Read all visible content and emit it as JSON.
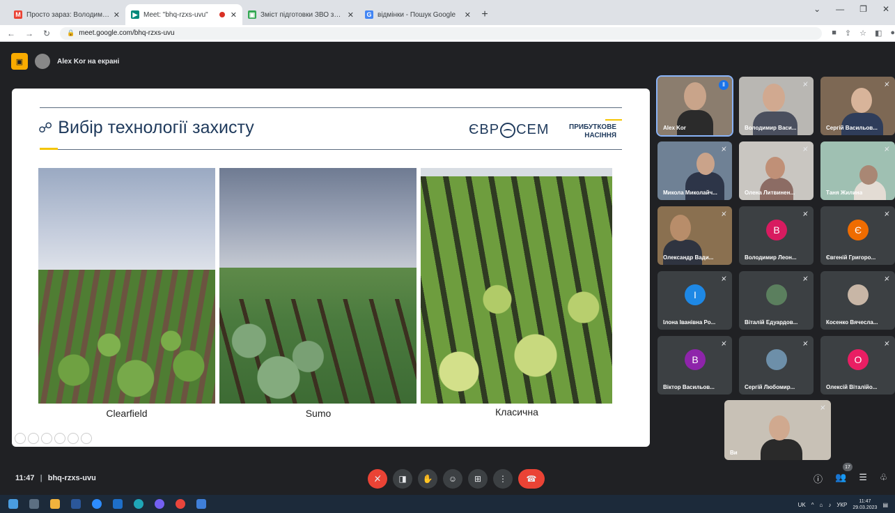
{
  "browser": {
    "tabs": [
      {
        "title": "Просто зараз: Володимир Вас...",
        "fav_color": "#ea4335",
        "fav": "M"
      },
      {
        "title": "Meet: \"bhq-rzxs-uvu\"",
        "fav_color": "#00897b",
        "fav": "▶"
      },
      {
        "title": "Зміст підготовки ЗВО за освітн...",
        "fav_color": "#34a853",
        "fav": "▣"
      },
      {
        "title": "відмінки - Пошук Google",
        "fav_color": "#4285f4",
        "fav": "G"
      }
    ],
    "url": "meet.google.com/bhq-rzxs-uvu"
  },
  "meet": {
    "presenter_label": "Alex Kor на екрані",
    "meeting_code": "bhq-rzxs-uvu",
    "time": "11:47",
    "participants_count": "17",
    "slide": {
      "title": "Вибір технології захисту",
      "brand_left": "ЄВР",
      "brand_right": "СЕМ",
      "brand_sub1": "ПРИБУТКОВЕ",
      "brand_sub2": "НАСІННЯ",
      "captions": [
        "Clearfield",
        "Sumo",
        "Класична"
      ]
    },
    "participants": [
      {
        "name": "Alex Kor"
      },
      {
        "name": "Володимир Васи..."
      },
      {
        "name": "Сергій Васильов..."
      },
      {
        "name": "Микола Миколайч..."
      },
      {
        "name": "Олена Литвинен..."
      },
      {
        "name": "Таня Жилина"
      },
      {
        "name": "Олександр Вади..."
      },
      {
        "name": "Володимир Леон...",
        "initial": "В"
      },
      {
        "name": "Євгеній Григоро...",
        "initial": "Є"
      },
      {
        "name": "Ілона Іванівна Ро...",
        "initial": "І"
      },
      {
        "name": "Віталій Едуардов..."
      },
      {
        "name": "Косенко Вячесла..."
      },
      {
        "name": "Віктор Васильов...",
        "initial": "В"
      },
      {
        "name": "Сергій Любомир..."
      },
      {
        "name": "Олексій Віталійо...",
        "initial": "О"
      },
      {
        "name": "Ви"
      }
    ]
  },
  "taskbar": {
    "lang": "УКР",
    "time": "11:47",
    "date": "29.03.2023",
    "tray_kb": "UK"
  }
}
